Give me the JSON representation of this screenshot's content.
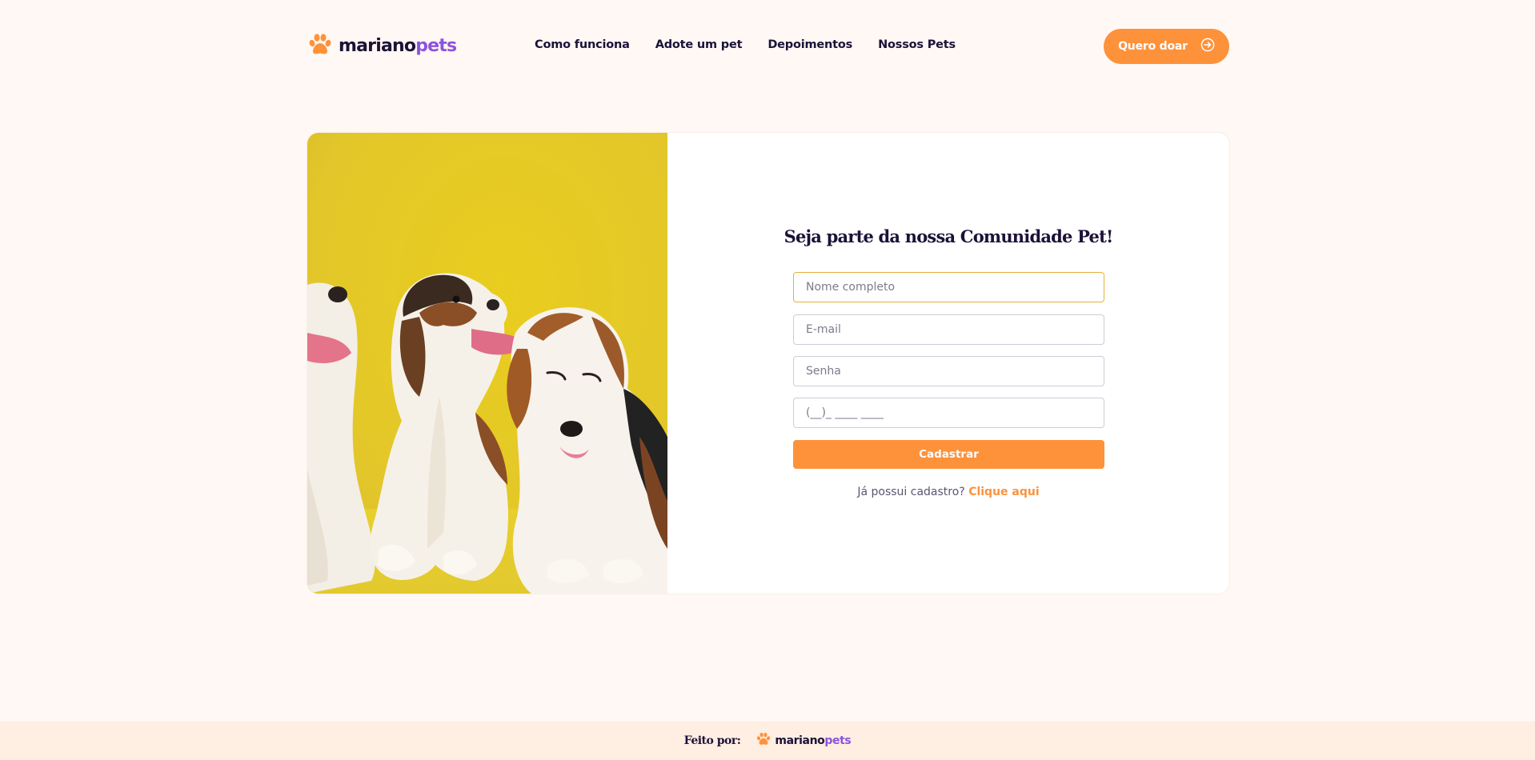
{
  "brand": {
    "name_part1": "mariano",
    "name_part2": "pets",
    "icon": "paw-icon",
    "primary_color": "#fd923b",
    "accent_color": "#8c54dd"
  },
  "nav": {
    "items": [
      {
        "label": "Como funciona"
      },
      {
        "label": "Adote um pet"
      },
      {
        "label": "Depoimentos"
      },
      {
        "label": "Nossos Pets"
      }
    ]
  },
  "header": {
    "cta_label": "Quero doar",
    "cta_icon": "arrow-right-circle-icon"
  },
  "signup": {
    "title": "Seja parte da nossa Comunidade Pet!",
    "fields": {
      "name_placeholder": "Nome completo",
      "email_placeholder": "E-mail",
      "password_placeholder": "Senha",
      "phone_placeholder": "(__)_ ____ ____"
    },
    "submit_label": "Cadastrar",
    "login_prompt": "Já possui cadastro?",
    "login_link": "Clique aqui"
  },
  "footer": {
    "made_by": "Feito por:"
  }
}
